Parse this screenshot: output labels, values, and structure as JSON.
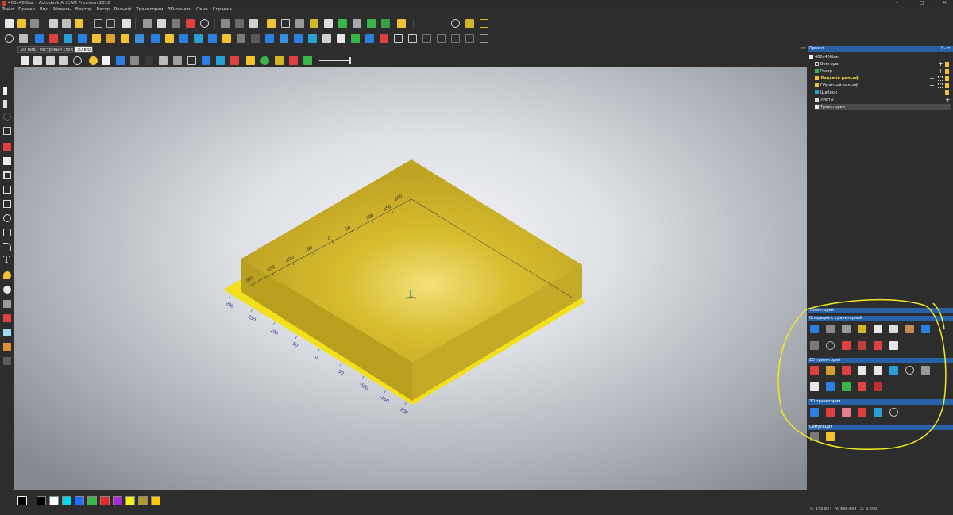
{
  "window": {
    "title": "400x400bar - Autodesk ArtCAM Premium 2018",
    "controls": [
      "–",
      "□",
      "✕"
    ]
  },
  "menu": [
    "Файл",
    "Правка",
    "Вид",
    "Модель",
    "Вектор",
    "Растр",
    "Рельеф",
    "Траектории",
    "3D-печать",
    "Окно",
    "Справка"
  ],
  "doc_tabs": [
    {
      "label": "2D Вид - Растровый слой"
    },
    {
      "label": "3D вид",
      "active": true
    }
  ],
  "project": {
    "header": "Проект",
    "header_controls": "? ₊ ✕",
    "root": "400x400bar",
    "items": [
      "Векторы",
      "Растр",
      "Лицевой рельеф",
      "Обратный рельеф",
      "Шаблон",
      "Листы",
      "Траектории"
    ]
  },
  "toolpaths": {
    "header": "Траектории",
    "sections": [
      "Операции с траекторией",
      "2D траектории",
      "3D траектории",
      "Симуляция"
    ]
  },
  "model": {
    "ruler_front": [
      "-200",
      "-150",
      "-100",
      "-50",
      "0",
      "50",
      "100",
      "150",
      "200"
    ],
    "ruler_left": [
      "200",
      "150",
      "100",
      "50",
      "0",
      "-50",
      "-100",
      "-150",
      "-200"
    ]
  },
  "status": {
    "x": "X: 173.834",
    "y": "Y: 388.693",
    "z": "Z: 0.000"
  },
  "colors": {
    "panel": "#2d2d2d",
    "header_blue": "#2762a8",
    "model_yellow": "#d4b727",
    "annotation": "#f2ea1c"
  },
  "palette": [
    "#000000",
    "#ffffff",
    "#00d8f0",
    "#1e6fff",
    "#39b54a",
    "#e6262a",
    "#a42bd6",
    "#f0ef1b",
    "#b09a2a",
    "#ffc800"
  ]
}
